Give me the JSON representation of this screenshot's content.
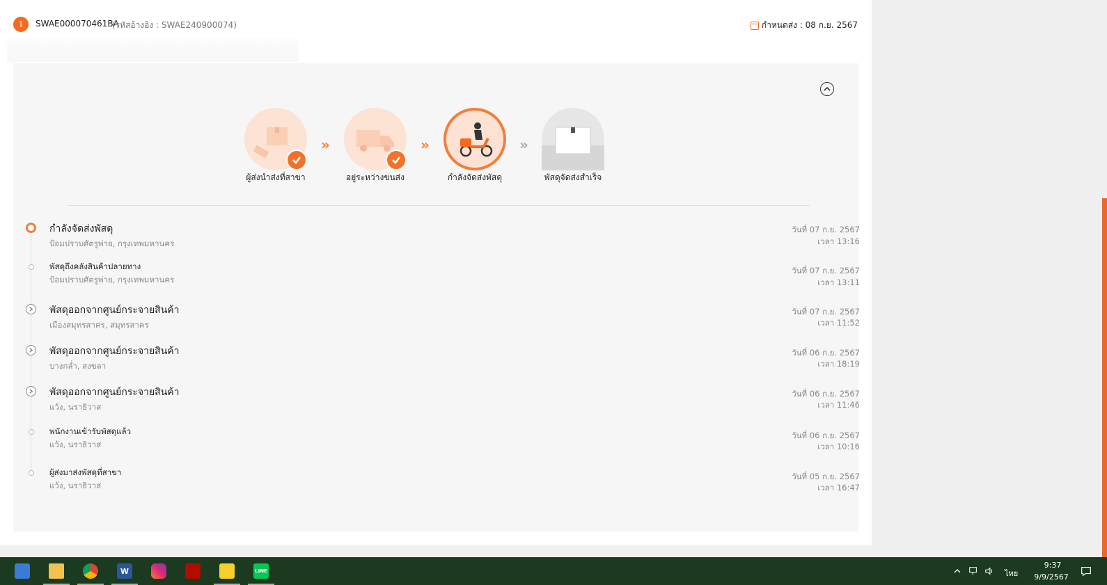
{
  "header": {
    "index": "1",
    "tracking_code": "SWAE000070461BA",
    "reference": "(รหัสอ้างอิง : SWAE240900074)",
    "due_date": "กำหนดส่ง : 08 ก.ย. 2567"
  },
  "steps": [
    {
      "label": "ผู้ส่งนำส่งที่สาขา",
      "state": "done",
      "icon": "parcel-drop-icon"
    },
    {
      "label": "อยู่ระหว่างขนส่ง",
      "state": "done",
      "icon": "delivery-truck-icon"
    },
    {
      "label": "กำลังจัดส่งพัสดุ",
      "state": "current",
      "icon": "courier-scooter-icon"
    },
    {
      "label": "พัสดุจัดส่งสำเร็จ",
      "state": "pending",
      "icon": "delivered-box-icon"
    }
  ],
  "events": [
    {
      "title": "กำลังจัดส่งพัสดุ",
      "place": "ป้อมปราบศัตรูพ่าย, กรุงเทพมหานคร",
      "date": "วันที่ 07 ก.ย. 2567",
      "time": "เวลา 13:16",
      "marker": "current"
    },
    {
      "title": "พัสดุถึงคลังสินค้าปลายทาง",
      "place": "ป้อมปราบศัตรูพ่าย, กรุงเทพมหานคร",
      "date": "วันที่ 07 ก.ย. 2567",
      "time": "เวลา 13:11",
      "marker": "small"
    },
    {
      "title": "พัสดุออกจากศูนย์กระจายสินค้า",
      "place": "เมืองสมุทรสาคร, สมุทรสาคร",
      "date": "วันที่ 07 ก.ย. 2567",
      "time": "เวลา 11:52",
      "marker": "chevron"
    },
    {
      "title": "พัสดุออกจากศูนย์กระจายสินค้า",
      "place": "บางกล่ำ, สงขลา",
      "date": "วันที่ 06 ก.ย. 2567",
      "time": "เวลา 18:19",
      "marker": "chevron"
    },
    {
      "title": "พัสดุออกจากศูนย์กระจายสินค้า",
      "place": "แว้ง, นราธิวาส",
      "date": "วันที่ 06 ก.ย. 2567",
      "time": "เวลา 11:46",
      "marker": "chevron"
    },
    {
      "title": "พนักงานเข้ารับพัสดุแล้ว",
      "place": "แว้ง, นราธิวาส",
      "date": "วันที่ 06 ก.ย. 2567",
      "time": "เวลา 10:16",
      "marker": "small"
    },
    {
      "title": "ผู้ส่งมาส่งพัสดุที่สาขา",
      "place": "แว้ง, นราธิวาส",
      "date": "วันที่ 05 ก.ย. 2567",
      "time": "เวลา 16:47",
      "marker": "small"
    }
  ],
  "colors": {
    "accent": "#f26b21",
    "done_bg": "#fde2d3",
    "pending_bg": "#e6e6e6",
    "taskbar": "#1c3a1f"
  },
  "taskbar": {
    "apps": [
      {
        "name": "news-widget-icon"
      },
      {
        "name": "file-explorer-icon"
      },
      {
        "name": "chrome-icon"
      },
      {
        "name": "word-icon",
        "text": "W"
      },
      {
        "name": "instagram-icon"
      },
      {
        "name": "acrobat-icon"
      },
      {
        "name": "sticky-notes-icon"
      },
      {
        "name": "line-icon",
        "text": "LINE"
      }
    ],
    "language": "ไทย",
    "time": "9:37",
    "date": "9/9/2567"
  }
}
